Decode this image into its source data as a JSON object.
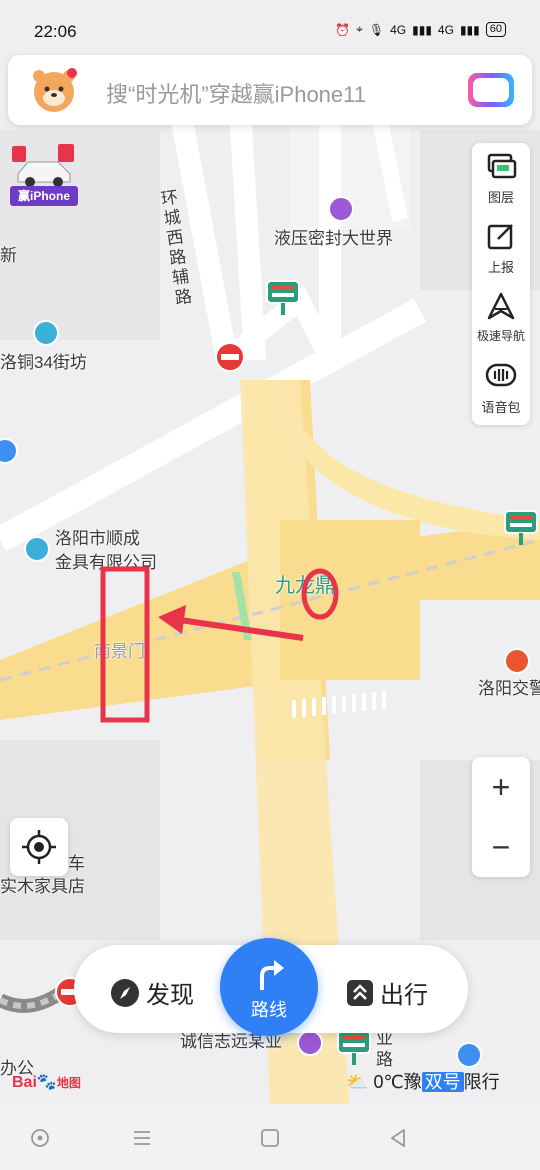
{
  "status_bar": {
    "time": "22:06",
    "network": "4G",
    "network2": "4G",
    "battery": "60"
  },
  "search": {
    "placeholder": "搜“时光机”穿越赢iPhone11"
  },
  "promo": {
    "label": "赢iPhone"
  },
  "right_tools": [
    {
      "label": "图层",
      "icon": "layers-icon"
    },
    {
      "label": "上报",
      "icon": "report-icon"
    },
    {
      "label": "极速导航",
      "icon": "fast-nav-icon"
    },
    {
      "label": "语音包",
      "icon": "voice-pack-icon"
    }
  ],
  "zoom": {
    "in": "+",
    "out": "−"
  },
  "map_labels": {
    "ring_road": "环城西路辅路",
    "hydraulic_store": "液压密封大世界",
    "luotong": "洛铜34街坊",
    "shuncheng_1": "洛阳市顺成",
    "shuncheng_2": "金具有限公司",
    "jiulong": "九龙鼎",
    "nanjingmen": "南景门",
    "luoyang_traffic": "洛阳交警",
    "furniture_1": "车",
    "furniture_2": "实木家具店",
    "chengxin": "诚信志远某业",
    "ye": "业",
    "lu": "路",
    "ban_gong": "办公",
    "xin": "新"
  },
  "bottom_bar": {
    "discover": "发现",
    "route": "路线",
    "travel": "出行"
  },
  "footer": {
    "logo_text": "Baidu地图",
    "weather": "0℃",
    "plate_prefix": "豫",
    "plate_badge": "双号",
    "plate_suffix": "限行"
  },
  "colors": {
    "road_yellow": "#f9dc8e",
    "road_fill": "#fbe7a8",
    "accent_blue": "#2f7ff5",
    "annotation_red": "#e8344a",
    "map_bg": "#efeff1"
  }
}
